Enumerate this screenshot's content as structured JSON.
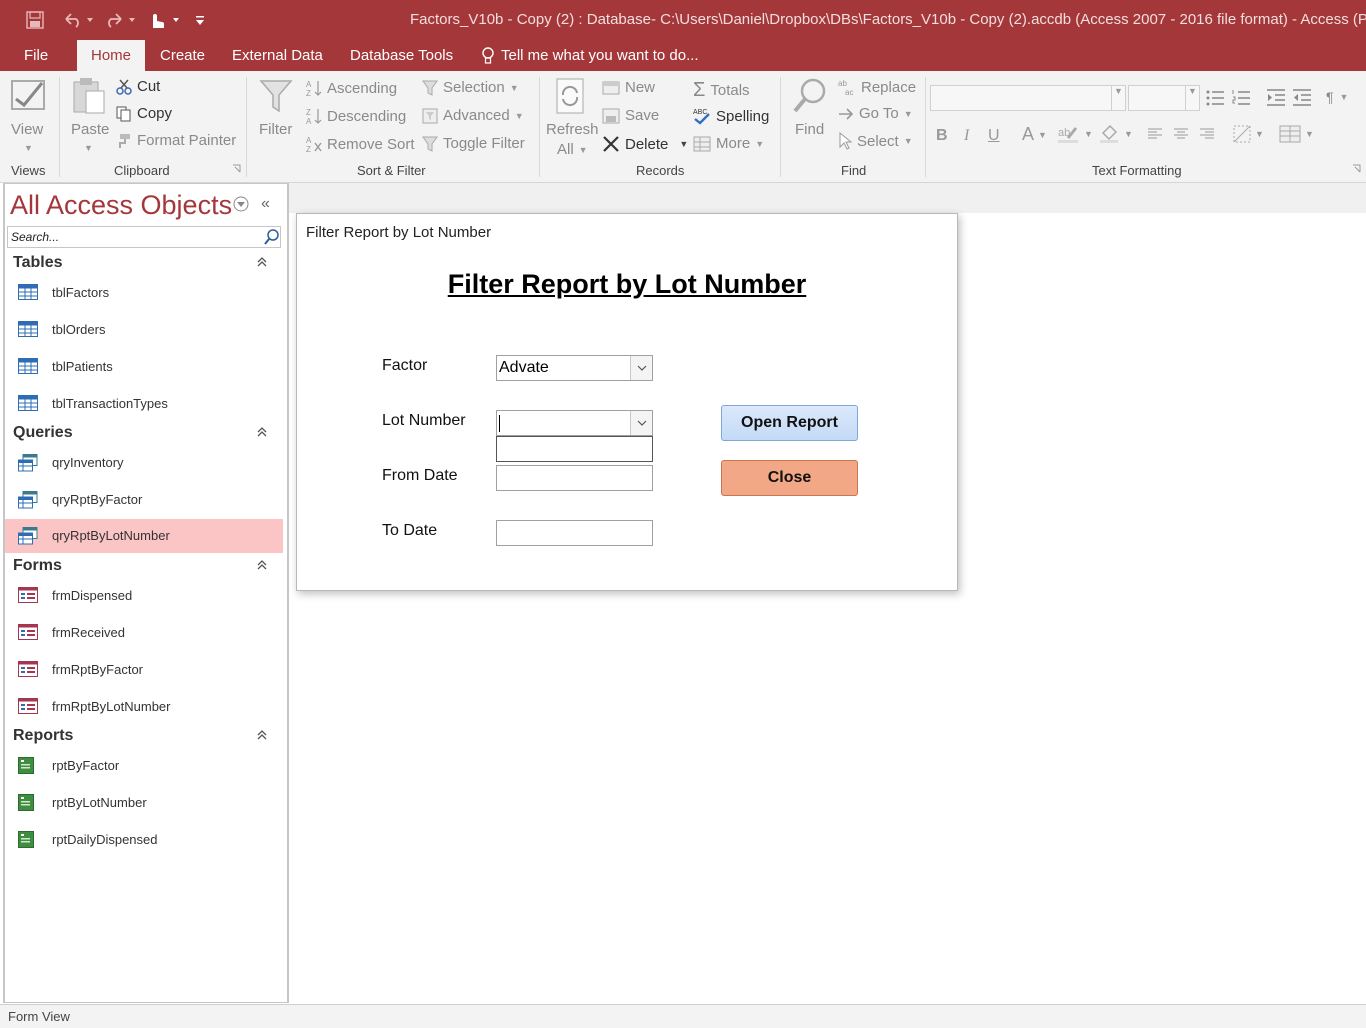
{
  "window": {
    "title": "Factors_V10b - Copy (2) : Database- C:\\Users\\Daniel\\Dropbox\\DBs\\Factors_V10b - Copy (2).accdb (Access 2007 - 2016 file format) - Access (Prod"
  },
  "quick_access": {
    "icons": [
      "save-icon",
      "undo-icon",
      "redo-icon",
      "touch-mode-icon",
      "customize-icon"
    ]
  },
  "tabs": [
    {
      "label": "File"
    },
    {
      "label": "Home",
      "active": true
    },
    {
      "label": "Create"
    },
    {
      "label": "External Data"
    },
    {
      "label": "Database Tools"
    }
  ],
  "tell_me": "Tell me what you want to do...",
  "ribbon": {
    "views": {
      "group": "Views",
      "view": "View"
    },
    "clipboard": {
      "group": "Clipboard",
      "paste": "Paste",
      "cut": "Cut",
      "copy": "Copy",
      "format_painter": "Format Painter"
    },
    "sort_filter": {
      "group": "Sort & Filter",
      "filter": "Filter",
      "ascending": "Ascending",
      "descending": "Descending",
      "remove_sort": "Remove Sort",
      "selection": "Selection",
      "advanced": "Advanced",
      "toggle_filter": "Toggle Filter"
    },
    "records": {
      "group": "Records",
      "refresh": "Refresh",
      "refresh_all": "All",
      "new": "New",
      "save": "Save",
      "delete": "Delete",
      "totals": "Totals",
      "spelling": "Spelling",
      "more": "More"
    },
    "find": {
      "group": "Find",
      "find": "Find",
      "replace": "Replace",
      "go_to": "Go To",
      "select": "Select"
    },
    "text_formatting": {
      "group": "Text Formatting",
      "bold": "B",
      "italic": "I",
      "underline": "U",
      "font_color": "A"
    }
  },
  "nav": {
    "title": "All Access Objects",
    "search_placeholder": "Search...",
    "groups": [
      {
        "label": "Tables",
        "items": [
          "tblFactors",
          "tblOrders",
          "tblPatients",
          "tblTransactionTypes"
        ]
      },
      {
        "label": "Queries",
        "items": [
          "qryInventory",
          "qryRptByFactor",
          "qryRptByLotNumber"
        ]
      },
      {
        "label": "Forms",
        "items": [
          "frmDispensed",
          "frmReceived",
          "frmRptByFactor",
          "frmRptByLotNumber"
        ]
      },
      {
        "label": "Reports",
        "items": [
          "rptByFactor",
          "rptByLotNumber",
          "rptDailyDispensed"
        ]
      }
    ],
    "selected_item": "qryRptByLotNumber"
  },
  "form": {
    "caption": "Filter Report by Lot Number",
    "heading": "Filter Report by Lot Number",
    "factor_label": "Factor",
    "factor_value": "Advate",
    "lot_label": "Lot Number",
    "lot_value": "",
    "from_label": "From Date",
    "from_value": "",
    "to_label": "To Date",
    "to_value": "",
    "open_report": "Open Report",
    "close": "Close"
  },
  "colors": {
    "accent": "#a4373a",
    "selected_nav": "#fbc5c6",
    "open_button": "#c3daf7",
    "close_button": "#f2a887"
  },
  "status": {
    "view": "Form View"
  }
}
